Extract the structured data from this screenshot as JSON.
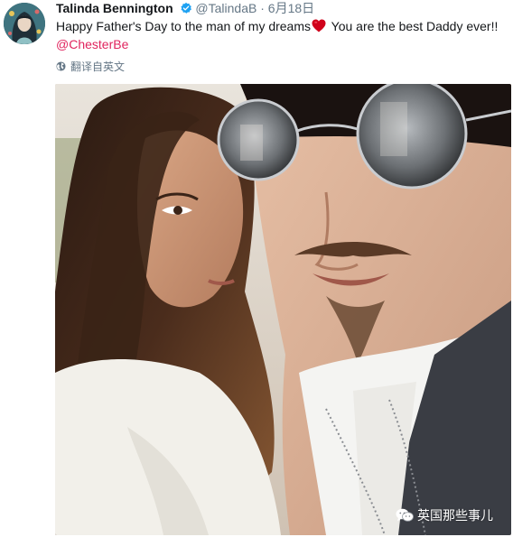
{
  "tweet": {
    "display_name": "Talinda Bennington",
    "handle": "@TalindaB",
    "separator": "·",
    "date": "6月18日",
    "text_before_heart": "Happy Father's Day to the man of my dreams",
    "text_after_heart": " You are the best Daddy ever!!",
    "mention": "@ChesterBe",
    "translate_label": "翻译自英文"
  },
  "icons": {
    "verified": "verified-badge-icon",
    "heart": "heart-emoji-icon",
    "translate": "globe-icon",
    "watermark": "wechat-icon"
  },
  "watermark": {
    "text": "英国那些事儿"
  },
  "colors": {
    "text_primary": "#14171a",
    "text_secondary": "#657786",
    "verified_blue": "#1da1f2",
    "mention_red": "#e0245e",
    "heart_red": "#d0021b"
  }
}
